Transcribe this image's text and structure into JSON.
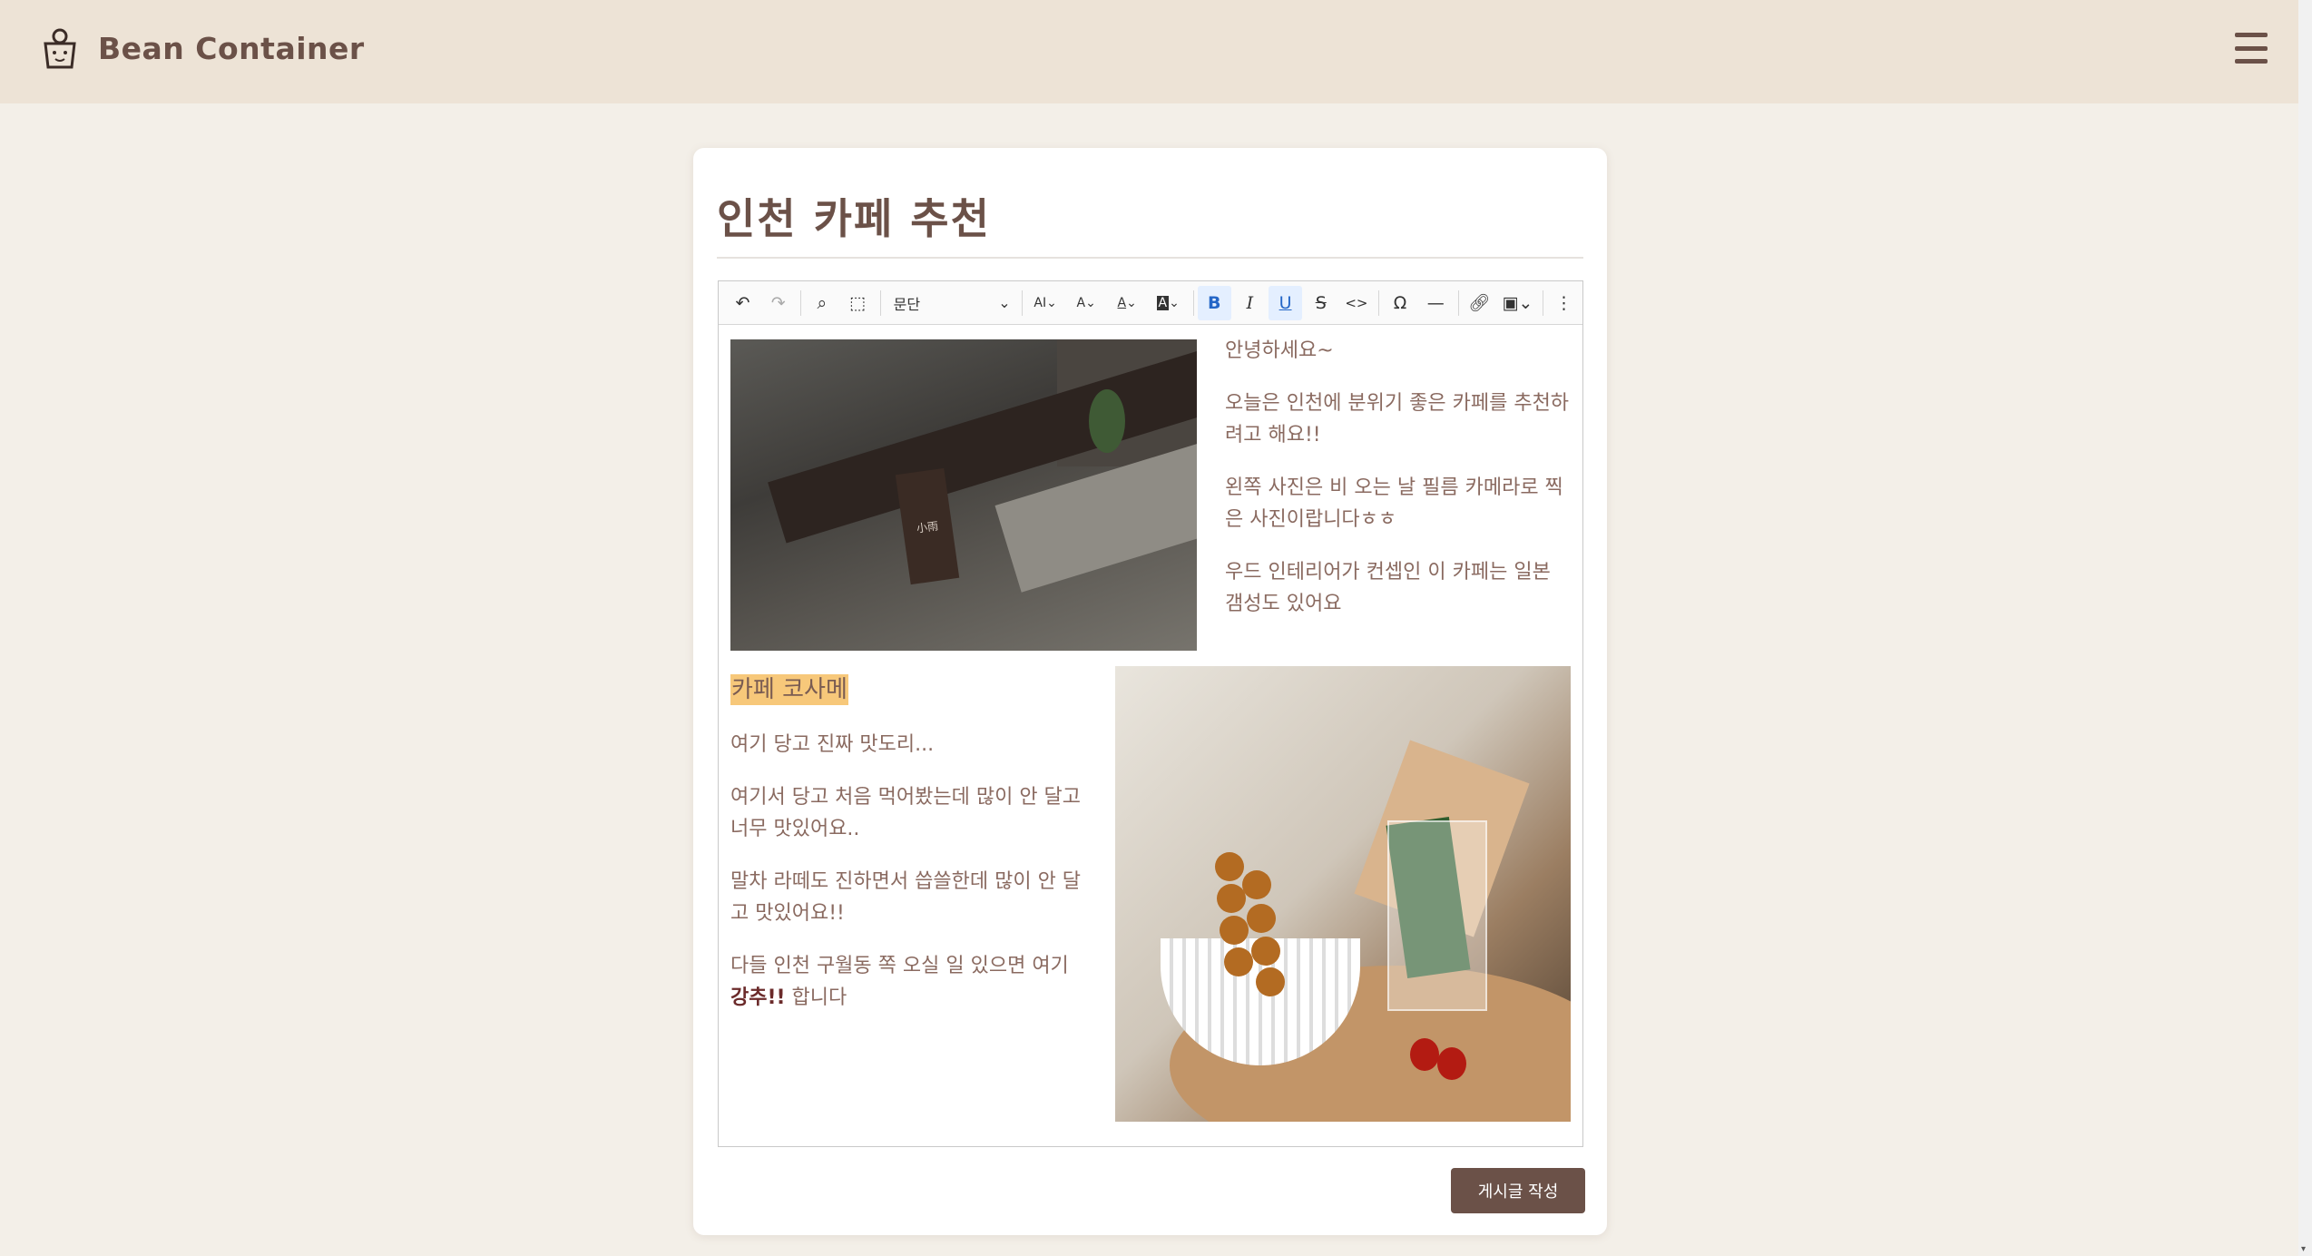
{
  "header": {
    "brand": "Bean Container",
    "logo_icon": "cup-face-icon",
    "menu_icon": "hamburger-icon"
  },
  "post": {
    "title": "인천 카페 추천"
  },
  "toolbar": {
    "undo_icon": "undo-icon",
    "redo_icon": "redo-icon",
    "find_icon": "find-replace-icon",
    "select_all_icon": "select-all-icon",
    "paragraph_style": "문단",
    "font_family_label": "AI",
    "font_size_label": "A",
    "font_color_label": "A",
    "bg_color_label": "A",
    "bold_label": "B",
    "italic_label": "I",
    "underline_label": "U",
    "strikethrough_label": "S",
    "code_label": "<>",
    "special_char_label": "Ω",
    "hr_label": "—",
    "link_icon": "link-icon",
    "image_icon": "image-upload-icon",
    "more_icon": "more-vertical-icon"
  },
  "content": {
    "right_paragraphs": [
      "안녕하세요~",
      "오늘은 인천에 분위기 좋은 카페를 추천하려고 해요!!",
      "왼쪽 사진은 비 오는 날 필름 카메라로 찍은 사진이랍니다ㅎㅎ",
      "우드 인테리어가 컨셉인 이 카페는 일본 갬성도 있어요"
    ],
    "heading": "카페 코사메",
    "left_paragraphs": [
      "여기 당고 진짜 맛도리...",
      "여기서 당고 처음 먹어봤는데 많이 안 달고 너무 맛있어요..",
      "말차 라떼도 진하면서 씁쓸한데 많이 안 달고 맛있어요!!"
    ],
    "last_paragraph_before": "다들 인천 구월동 쪽 오실 일 있으면 여기 ",
    "last_paragraph_bold": "강추!!",
    "last_paragraph_after": " 합니다"
  },
  "actions": {
    "submit_label": "게시글 작성"
  },
  "colors": {
    "header_bg": "#ede3d6",
    "page_bg": "#f3efe8",
    "brand": "#6b5148",
    "highlight": "#f7c87a"
  }
}
